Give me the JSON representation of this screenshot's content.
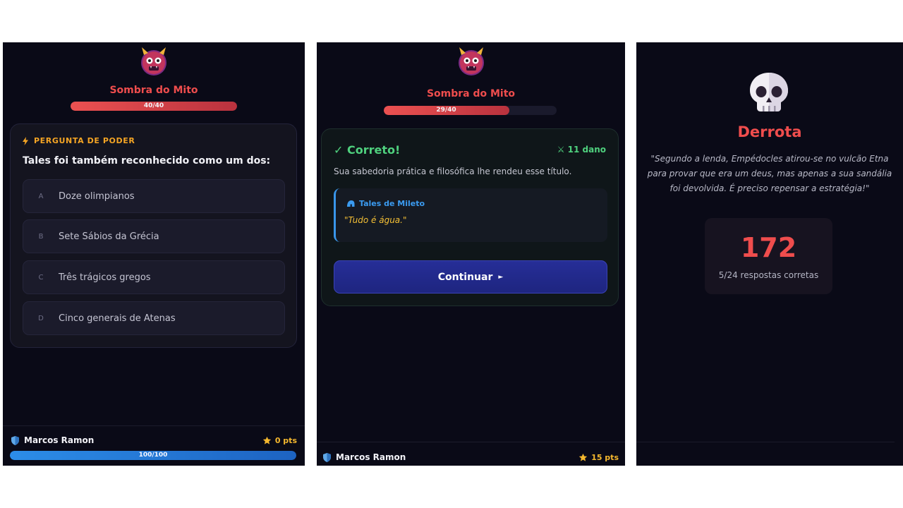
{
  "screens": [
    {
      "boss": {
        "name": "Sombra do Mito",
        "hp_text": "40/40",
        "hp_fraction": 1.0
      },
      "question": {
        "category": "PERGUNTA DE PODER",
        "text": "Tales foi também reconhecido como um dos:",
        "options": [
          {
            "letter": "A",
            "label": "Doze olimpianos"
          },
          {
            "letter": "B",
            "label": "Sete Sábios da Grécia"
          },
          {
            "letter": "C",
            "label": "Três trágicos gregos"
          },
          {
            "letter": "D",
            "label": "Cinco generais de Atenas"
          }
        ]
      },
      "player": {
        "name": "Marcos Ramon",
        "points": "0 pts",
        "hp_text": "100/100",
        "hp_fraction": 1.0
      }
    },
    {
      "boss": {
        "name": "Sombra do Mito",
        "hp_text": "29/40",
        "hp_fraction": 0.725
      },
      "result": {
        "title": "✓ Correto!",
        "damage": "⚔ 11 dano",
        "message": "Sua sabedoria prática e filosófica lhe rendeu esse título.",
        "quote_author": "Tales de Mileto",
        "quote": "\"Tudo é água.\"",
        "continue_label": "Continuar",
        "continue_arrow": "►"
      },
      "player": {
        "name": "Marcos Ramon",
        "points": "15 pts"
      }
    },
    {
      "title": "Derrota",
      "message": "\"Segundo a lenda, Empédocles atirou-se no vulcão Etna para provar que era um deus, mas apenas a sua sandália foi devolvida. É preciso repensar a estratégia!\"",
      "score": "172",
      "score_label": "5/24 respostas corretas"
    }
  ],
  "colors": {
    "background": "#0a0a17",
    "danger": "#ef4d4d",
    "success": "#4fd17e",
    "gold": "#f5b82e",
    "info": "#3b9bf0",
    "button": "#262e97"
  },
  "icons": {
    "boss": "demon-face-icon",
    "category": "lightning-icon",
    "player": "shield-icon",
    "points": "star-icon",
    "quote": "helmet-icon",
    "defeat": "skull-icon"
  }
}
